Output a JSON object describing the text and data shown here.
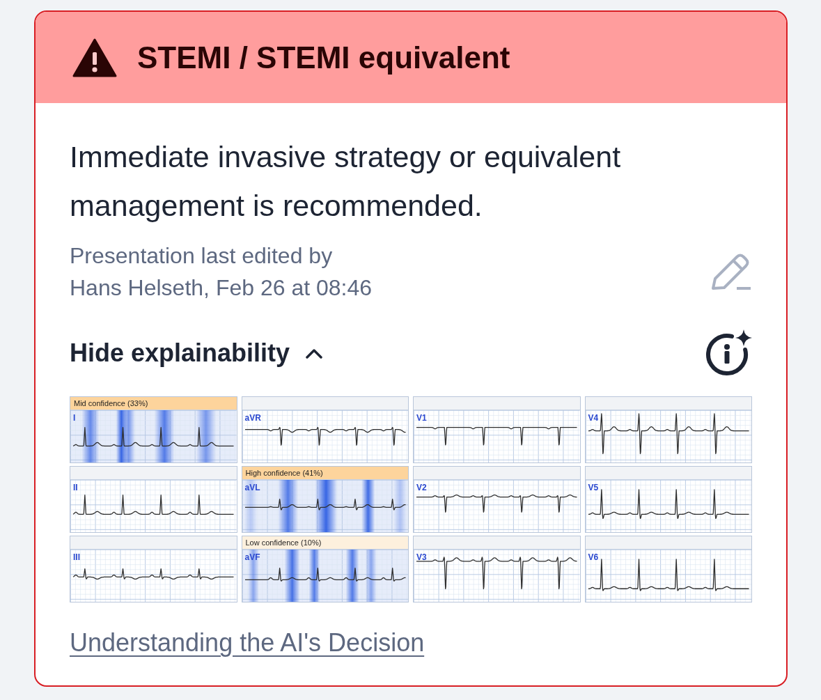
{
  "alert": {
    "title": "STEMI / STEMI equivalent"
  },
  "recommendation": "Immediate invasive strategy or equivalent management is recommended.",
  "last_edited": {
    "label": "Presentation last edited by",
    "details": "Hans Helseth, Feb 26 at 08:46"
  },
  "explainability": {
    "toggle_label": "Hide explainability",
    "expanded": true,
    "leads": [
      {
        "name": "I",
        "confidence": {
          "label": "Mid confidence (33%)",
          "color": "#fdd49c"
        }
      },
      {
        "name": "aVR"
      },
      {
        "name": "V1"
      },
      {
        "name": "V4"
      },
      {
        "name": "II"
      },
      {
        "name": "aVL",
        "confidence": {
          "label": "High confidence (41%)",
          "color": "#fdd49c"
        }
      },
      {
        "name": "V2"
      },
      {
        "name": "V5"
      },
      {
        "name": "III"
      },
      {
        "name": "aVF",
        "confidence": {
          "label": "Low confidence (10%)",
          "color": "#fdf0dd"
        }
      },
      {
        "name": "V3"
      },
      {
        "name": "V6"
      }
    ]
  },
  "link": "Understanding the AI's Decision"
}
